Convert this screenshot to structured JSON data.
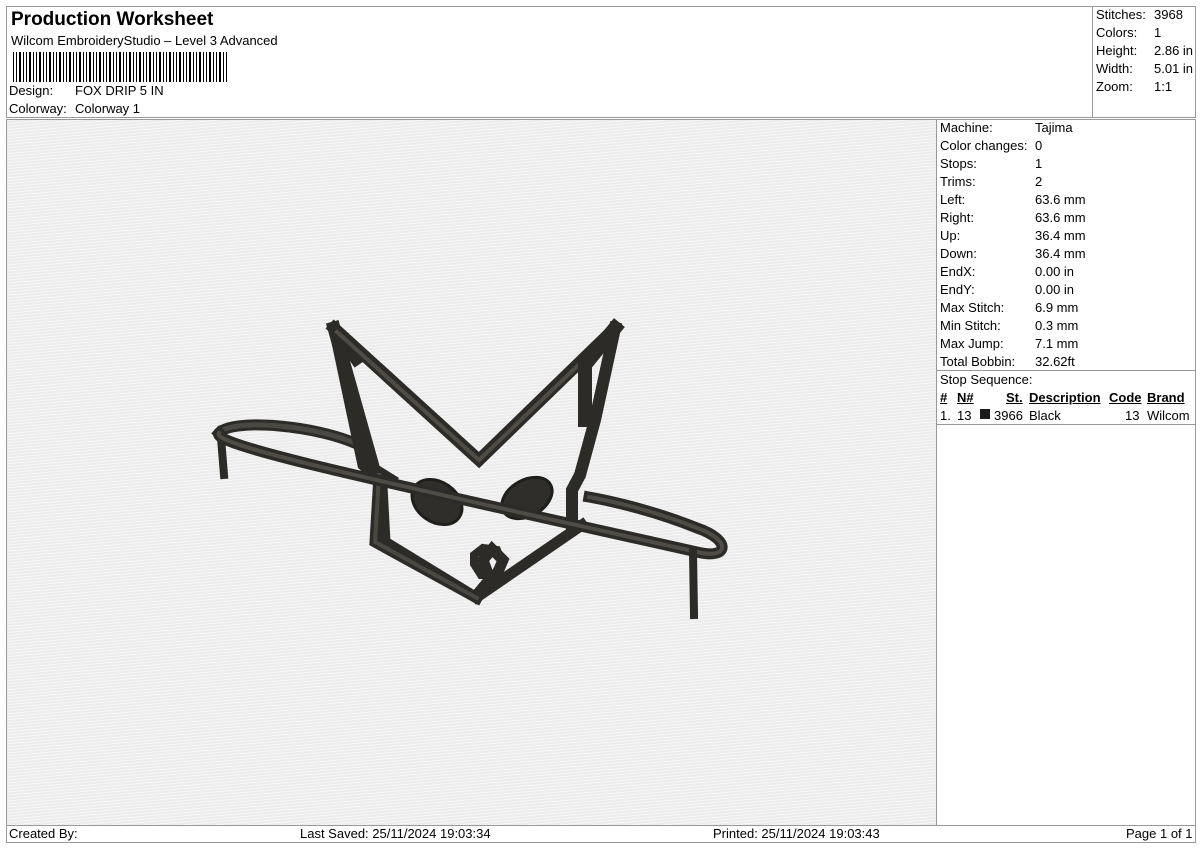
{
  "header": {
    "title": "Production Worksheet",
    "subtitle": "Wilcom EmbroideryStudio – Level 3 Advanced",
    "design_label": "Design:",
    "design_value": "FOX DRIP 5 IN",
    "colorway_label": "Colorway:",
    "colorway_value": "Colorway 1"
  },
  "stats": [
    {
      "label": "Stitches:",
      "value": "3968"
    },
    {
      "label": "Colors:",
      "value": "1"
    },
    {
      "label": "Height:",
      "value": "2.86 in"
    },
    {
      "label": "Width:",
      "value": "5.01 in"
    },
    {
      "label": "Zoom:",
      "value": "1:1"
    }
  ],
  "machine_info": [
    {
      "label": "Machine:",
      "value": "Tajima"
    },
    {
      "label": "Color changes:",
      "value": "0"
    },
    {
      "label": "Stops:",
      "value": "1"
    },
    {
      "label": "Trims:",
      "value": "2"
    },
    {
      "label": "Left:",
      "value": "63.6 mm"
    },
    {
      "label": "Right:",
      "value": "63.6 mm"
    },
    {
      "label": "Up:",
      "value": "36.4 mm"
    },
    {
      "label": "Down:",
      "value": "36.4 mm"
    },
    {
      "label": "EndX:",
      "value": "0.00 in"
    },
    {
      "label": "EndY:",
      "value": "0.00 in"
    },
    {
      "label": "Max Stitch:",
      "value": "6.9 mm"
    },
    {
      "label": "Min Stitch:",
      "value": "0.3 mm"
    },
    {
      "label": "Max Jump:",
      "value": "7.1 mm"
    },
    {
      "label": "Total Bobbin:",
      "value": "32.62ft"
    }
  ],
  "stop_sequence": {
    "title": "Stop Sequence:",
    "columns": {
      "idx": "#",
      "needle": "N#",
      "stitches": "St.",
      "description": "Description",
      "code": "Code",
      "brand": "Brand"
    },
    "rows": [
      {
        "idx": "1.",
        "needle": "13",
        "color": "#1a1a1a",
        "stitches": "3966",
        "description": "Black",
        "code": "13",
        "brand": "Wilcom"
      }
    ]
  },
  "footer": {
    "created_by": "Created By:",
    "last_saved": "Last Saved: 25/11/2024 19:03:34",
    "printed": "Printed: 25/11/2024 19:03:43",
    "page": "Page 1 of 1"
  },
  "colors": {
    "thread": "#3d3b36",
    "thread_dark": "#2a2925"
  }
}
